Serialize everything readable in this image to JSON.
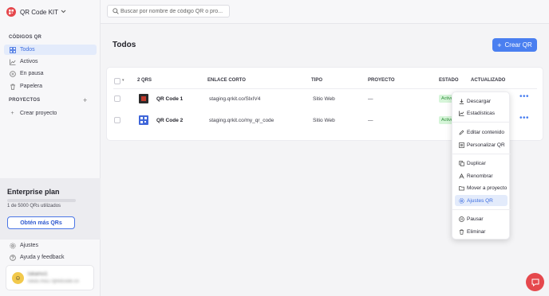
{
  "app": {
    "name": "QR Code KIT"
  },
  "sidebar": {
    "qr_section_label": "CÓDIGOS QR",
    "qr_items": [
      {
        "label": "Todos",
        "icon": "grid-icon",
        "active": true
      },
      {
        "label": "Activos",
        "icon": "chart-icon",
        "active": false
      },
      {
        "label": "En pausa",
        "icon": "pause-icon",
        "active": false
      },
      {
        "label": "Papelera",
        "icon": "trash-icon",
        "active": false
      }
    ],
    "projects_section_label": "PROYECTOS",
    "create_project_label": "Crear proyecto",
    "plan": {
      "title": "Enterprise plan",
      "usage_text": "1 de 5000 QRs utilizados",
      "usage_fraction": 0.0002,
      "cta_label": "Obtén más QRs"
    },
    "footer_items": [
      {
        "label": "Ajustes",
        "icon": "gear-icon"
      },
      {
        "label": "Ayuda y feedback",
        "icon": "help-icon"
      }
    ],
    "user": {
      "name": "lukamo1",
      "email": "lukas.ma17@kitcode.co"
    }
  },
  "search": {
    "placeholder": "Buscar por nombre de código QR o pro..."
  },
  "main": {
    "title": "Todos",
    "create_button_label": "Crear QR",
    "table": {
      "headers": {
        "count": "2 QRS",
        "short_link": "ENLACE CORTO",
        "type": "TIPO",
        "project": "PROYECTO",
        "status": "ESTADO",
        "updated": "ACTUALIZADO"
      },
      "rows": [
        {
          "name": "QR Code 1",
          "short_link": "staging.qrkit.co/SlxIV4",
          "type": "Sitio Web",
          "project": "—",
          "status": "Activo"
        },
        {
          "name": "QR Code 2",
          "short_link": "staging.qrkit.co/my_qr_code",
          "type": "Sitio Web",
          "project": "—",
          "status": "Activo"
        }
      ]
    }
  },
  "context_menu": {
    "items": [
      {
        "label": "Descargar",
        "icon": "download-icon",
        "active": false
      },
      {
        "label": "Estadísticas",
        "icon": "stats-icon",
        "active": false
      },
      {
        "label": "Editar contenido",
        "icon": "edit-icon",
        "active": false
      },
      {
        "label": "Personalizar QR",
        "icon": "qr-icon",
        "active": false
      },
      {
        "label": "Duplicar",
        "icon": "duplicate-icon",
        "active": false
      },
      {
        "label": "Renombrar",
        "icon": "rename-icon",
        "active": false
      },
      {
        "label": "Mover a proyecto",
        "icon": "folder-icon",
        "active": false
      },
      {
        "label": "Ajustes QR",
        "icon": "settings-icon",
        "active": true
      },
      {
        "label": "Pausar",
        "icon": "pause-icon",
        "active": false
      },
      {
        "label": "Eliminar",
        "icon": "trash-icon",
        "active": false
      }
    ]
  },
  "colors": {
    "accent": "#4a7ff0",
    "brand": "#e5484d",
    "active_bg": "#e3ebfb",
    "status_bg": "#d6f5d9",
    "status_text": "#2f8f3a"
  }
}
